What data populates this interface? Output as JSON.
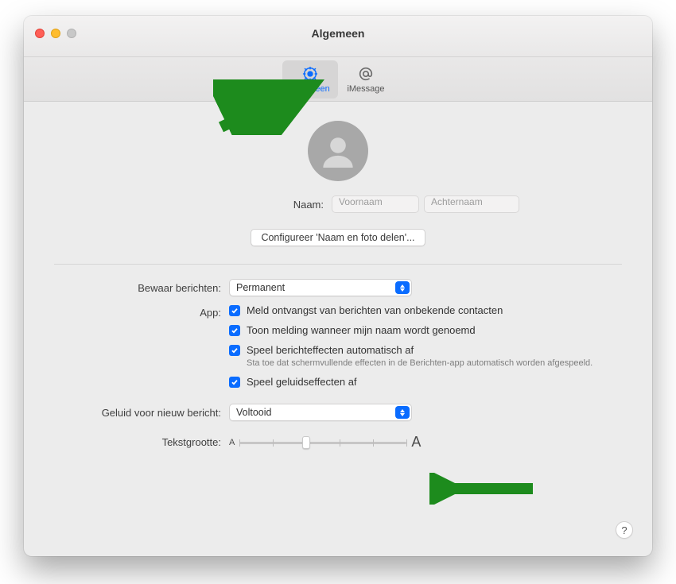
{
  "window": {
    "title": "Algemeen"
  },
  "tabs": {
    "general": "Algemeen",
    "imessage": "iMessage"
  },
  "labels": {
    "name": "Naam:",
    "keep_messages": "Bewaar berichten:",
    "app": "App:",
    "new_message_sound": "Geluid voor nieuw bericht:",
    "text_size": "Tekstgrootte:"
  },
  "inputs": {
    "firstname_placeholder": "Voornaam",
    "lastname_placeholder": "Achternaam"
  },
  "buttons": {
    "configure": "Configureer 'Naam en foto delen'...",
    "help": "?"
  },
  "selects": {
    "keep_messages_value": "Permanent",
    "new_message_sound_value": "Voltooid"
  },
  "checkboxes": {
    "notify_unknown": "Meld ontvangst van berichten van onbekende contacten",
    "mention_name": "Toon melding wanneer mijn naam wordt genoemd",
    "auto_effects": "Speel berichteffecten automatisch af",
    "auto_effects_sub": "Sta toe dat schermvullende effecten in de Berichten-app automatisch worden afgespeeld.",
    "sound_effects": "Speel geluidseffecten af"
  },
  "slider": {
    "small": "A",
    "large": "A",
    "ticks": 6,
    "value_index": 2
  }
}
